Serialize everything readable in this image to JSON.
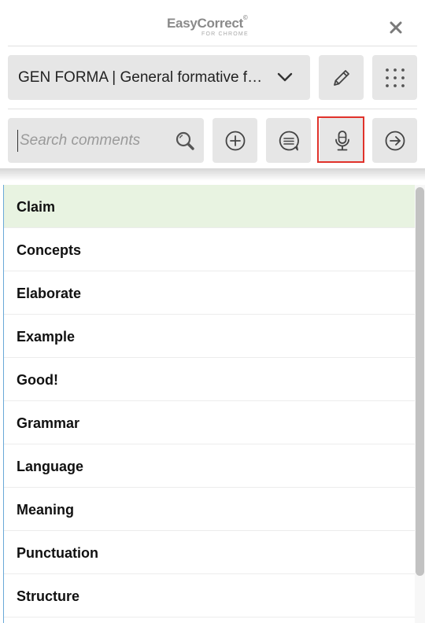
{
  "header": {
    "logo_title": "EasyCorrect",
    "logo_mark": "©",
    "logo_subtitle": "FOR CHROME",
    "close_icon": "close-icon"
  },
  "toolbar": {
    "template_select": {
      "selected": "GEN FORMA | General formative fe…",
      "chevron_icon": "chevron-down-icon"
    },
    "edit_icon": "pencil-icon",
    "grid_icon": "grid-dots-icon",
    "search": {
      "placeholder": "Search comments",
      "value": "",
      "icon": "search-icon"
    },
    "add_icon": "plus-circle-icon",
    "comment_icon": "speech-bubble-icon",
    "mic_icon": "microphone-icon",
    "next_icon": "arrow-right-circle-icon",
    "highlight_color": "#e0322b"
  },
  "comments": {
    "items": [
      {
        "label": "Claim",
        "selected": true
      },
      {
        "label": "Concepts",
        "selected": false
      },
      {
        "label": "Elaborate",
        "selected": false
      },
      {
        "label": "Example",
        "selected": false
      },
      {
        "label": "Good!",
        "selected": false
      },
      {
        "label": "Grammar",
        "selected": false
      },
      {
        "label": "Language",
        "selected": false
      },
      {
        "label": "Meaning",
        "selected": false
      },
      {
        "label": "Punctuation",
        "selected": false
      },
      {
        "label": "Structure",
        "selected": false
      }
    ],
    "selected_color": "#e8f3e1",
    "accent_color": "#6aa9d8"
  }
}
